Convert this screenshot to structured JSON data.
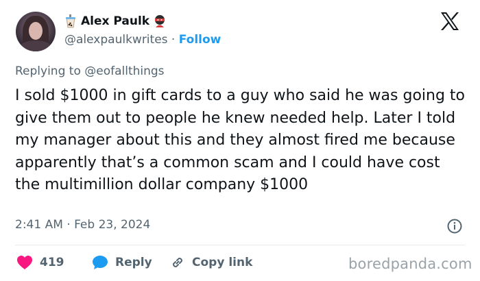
{
  "author": {
    "name": "Alex Paulk",
    "handle": "@alexpaulkwrites",
    "separator": "·",
    "follow_label": "Follow",
    "name_emoji_left": "bubble-tea-icon",
    "name_emoji_right": "ninja-icon"
  },
  "reply": {
    "prefix": "Replying to",
    "mention": "@eofallthings"
  },
  "tweet": {
    "text": "I sold $1000 in gift cards to a guy who said he was going to give them out to people he knew needed help. Later I told my manager about this and they almost fired me because apparently that’s a common scam and I could have cost the multimillion dollar company $1000"
  },
  "meta": {
    "timestamp": "2:41 AM · Feb 23, 2024"
  },
  "actions": {
    "likes_count": "419",
    "reply_label": "Reply",
    "copy_label": "Copy link"
  },
  "watermark": "boredpanda.com",
  "colors": {
    "accent": "#1d9bf0",
    "like": "#f91880",
    "text": "#0f1419",
    "muted": "#536471"
  }
}
